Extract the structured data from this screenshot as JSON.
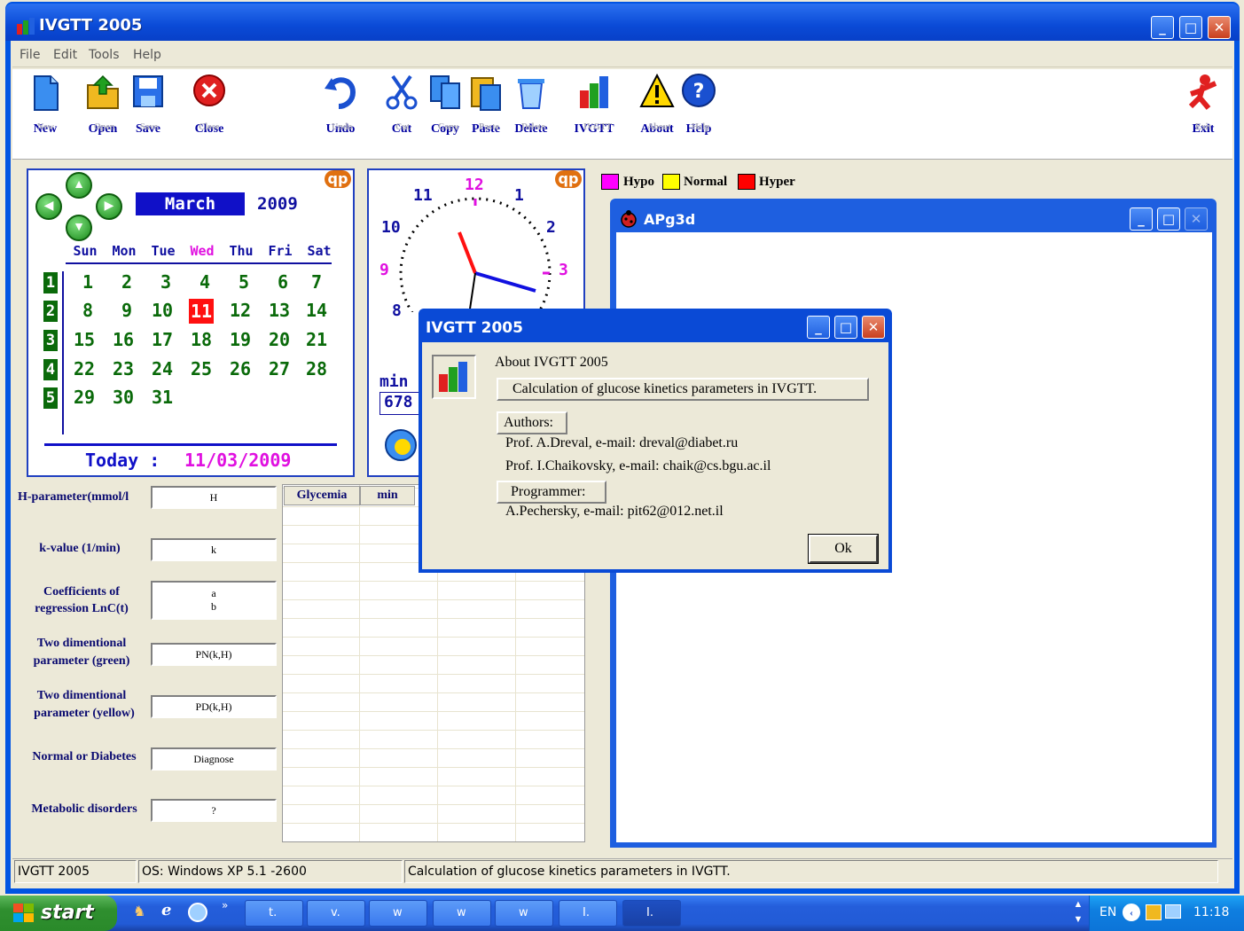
{
  "window": {
    "title": "IVGTT 2005"
  },
  "menu": [
    "File",
    "Edit",
    "Tools",
    "Help"
  ],
  "toolbar": {
    "new": "New",
    "new_ghost": "New",
    "open": "Open",
    "open_ghost": "Open",
    "save": "Save",
    "save_ghost": "Save",
    "close": "Close",
    "close_ghost": "Close",
    "undo": "Undo",
    "undo_ghost": "Undo",
    "cut": "Cut",
    "cut_ghost": "Cut",
    "copy": "Copy",
    "copy_ghost": "Copy",
    "paste": "Paste",
    "paste_ghost": "Paste",
    "delete": "Delete",
    "delete_ghost": "Delete",
    "ivgtt": "IVGTT",
    "ivgtt_ghost": "IVGTT",
    "about": "About",
    "about_ghost": "About",
    "help": "Help",
    "help_ghost": "Help",
    "exit": "Exit",
    "exit_ghost": "Exit"
  },
  "calendar": {
    "logo": "qp",
    "month": "March",
    "year": "2009",
    "days_of_week": [
      "Sun",
      "Mon",
      "Tue",
      "Wed",
      "Thu",
      "Fri",
      "Sat"
    ],
    "weeks": [
      "1",
      "2",
      "3",
      "4",
      "5"
    ],
    "rows": [
      [
        "1",
        "2",
        "3",
        "4",
        "5",
        "6",
        "7"
      ],
      [
        "8",
        "9",
        "10",
        "11",
        "12",
        "13",
        "14"
      ],
      [
        "15",
        "16",
        "17",
        "18",
        "19",
        "20",
        "21"
      ],
      [
        "22",
        "23",
        "24",
        "25",
        "26",
        "27",
        "28"
      ],
      [
        "29",
        "30",
        "31",
        "",
        "",
        "",
        ""
      ]
    ],
    "selected_day": "11",
    "today_label": "Today  :",
    "today_value": "11/03/2009"
  },
  "clock": {
    "logo": "qp",
    "numbers": {
      "n12": "12",
      "n11": "11",
      "n1": "1",
      "n10": "10",
      "n2": "2",
      "n9": "9",
      "n3": "3",
      "n8": "8"
    },
    "min_label": "min",
    "min_value": "678"
  },
  "legend": {
    "hypo": "Hypo",
    "normal": "Normal",
    "hyper": "Hyper",
    "colors": {
      "hypo": "#ff00ff",
      "normal": "#ffff00",
      "hyper": "#ff0000"
    }
  },
  "params": {
    "h_label": "H-parameter(mmol/l",
    "h_value": "H",
    "k_label": "k-value (1/min)",
    "k_value": "k",
    "coef_label1": "Coefficients of",
    "coef_label2": "regression LnC(t)",
    "coef_a": "a",
    "coef_b": "b",
    "pn_label1": "Two dimentional",
    "pn_label2": "parameter (green)",
    "pn_value": "PN(k,H)",
    "pd_label1": "Two dimentional",
    "pd_label2": "parameter (yellow)",
    "pd_value": "PD(k,H)",
    "nd_label": "Normal or Diabetes",
    "nd_value": "Diagnose",
    "md_label": "Metabolic disorders",
    "md_value": "?"
  },
  "grid": {
    "col_glycemia": "Glycemia",
    "col_min": "min"
  },
  "apg": {
    "title": "APg3d"
  },
  "dialog": {
    "title": "IVGTT 2005",
    "about": "About IVGTT 2005",
    "desc": "Calculation of glucose kinetics parameters in IVGTT.",
    "authors_label": "Authors:",
    "author1": "Prof. A.Dreval, e-mail: dreval@diabet.ru",
    "author2": "Prof. I.Chaikovsky, e-mail: chaik@cs.bgu.ac.il",
    "programmer_label": "Programmer:",
    "programmer": "A.Pechersky, e-mail: pit62@012.net.il",
    "ok": "Ok"
  },
  "status": {
    "app": "IVGTT 2005",
    "os": "OS: Windows XP    5.1 -2600",
    "desc": "Calculation of glucose kinetics parameters in IVGTT."
  },
  "taskbar": {
    "start": "start",
    "tasks": [
      "t.",
      "v.",
      "w",
      "w",
      "w",
      "I.",
      "I."
    ],
    "lang": "EN",
    "time": "11:18"
  }
}
